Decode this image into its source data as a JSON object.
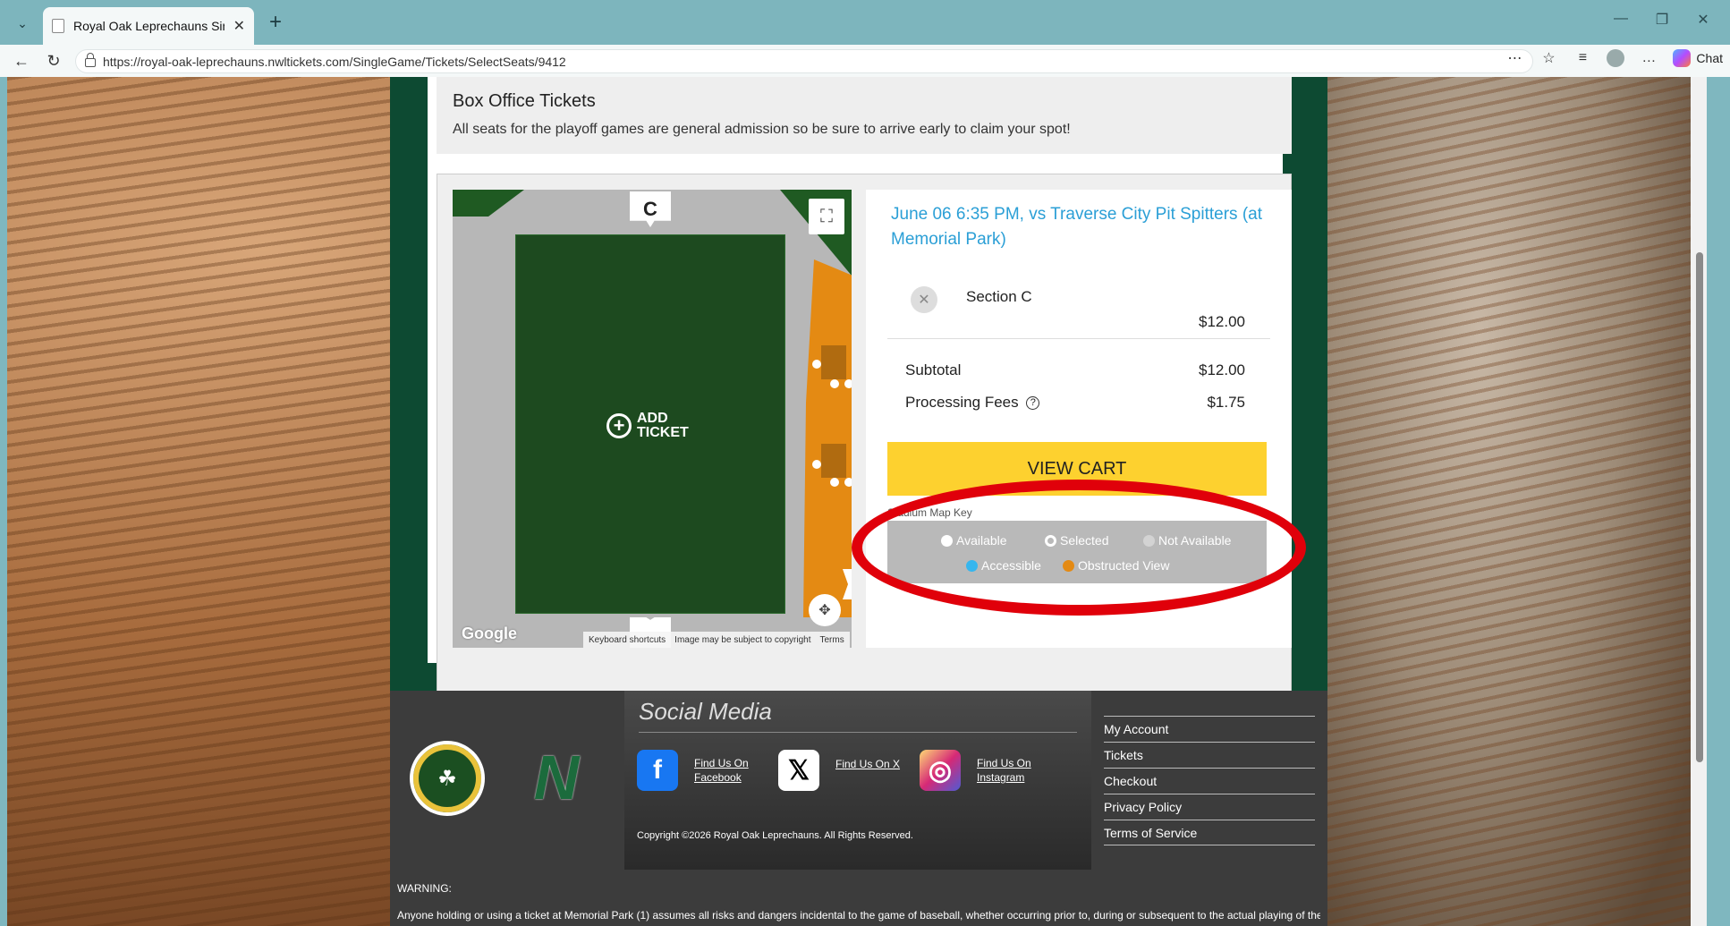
{
  "browser": {
    "tab_title": "Royal Oak Leprechauns Single Gar",
    "url": "https://royal-oak-leprechauns.nwltickets.com/SingleGame/Tickets/SelectSeats/9412",
    "chat_label": "Chat"
  },
  "box_office": {
    "title": "Box Office Tickets",
    "description": "All seats for the playoff games are general admission so be sure to arrive early to claim your spot!"
  },
  "map": {
    "section_marker": "C",
    "add_ticket_line1": "ADD",
    "add_ticket_line2": "TICKET",
    "google": "Google",
    "keyboard_shortcuts": "Keyboard shortcuts",
    "copyright_notice": "Image may be subject to copyright",
    "terms": "Terms"
  },
  "cart": {
    "game_title": "June 06 6:35 PM, vs Traverse City Pit Spitters (at Memorial Park)",
    "section": "Section C",
    "section_price": "$12.00",
    "subtotal_label": "Subtotal",
    "subtotal_value": "$12.00",
    "fees_label": "Processing Fees",
    "fees_value": "$1.75",
    "view_cart_label": "VIEW CART",
    "legend_title": "Stadium Map Key",
    "legend": {
      "available": "Available",
      "selected": "Selected",
      "not_available": "Not Available",
      "accessible": "Accessible",
      "obstructed": "Obstructed View"
    }
  },
  "footer": {
    "social_title": "Social Media",
    "facebook": "Find Us On Facebook",
    "x": "Find Us On X",
    "instagram": "Find Us On Instagram",
    "copyright": "Copyright ©2026 Royal Oak Leprechauns. All Rights Reserved.",
    "links": [
      "My Account",
      "Tickets",
      "Checkout",
      "Privacy Policy",
      "Terms of Service"
    ],
    "warning_title": "WARNING:",
    "warning_text": "Anyone holding or using a ticket at Memorial Park (1) assumes all risks and dangers incidental to the game of baseball, whether occurring prior to, during or subsequent to the actual playing of the game,"
  },
  "colors": {
    "accent_blue": "#2b9fd6",
    "view_cart_yellow": "#fdd12f",
    "highlight_red": "#e0000a",
    "frame_green": "#0d4a32"
  }
}
